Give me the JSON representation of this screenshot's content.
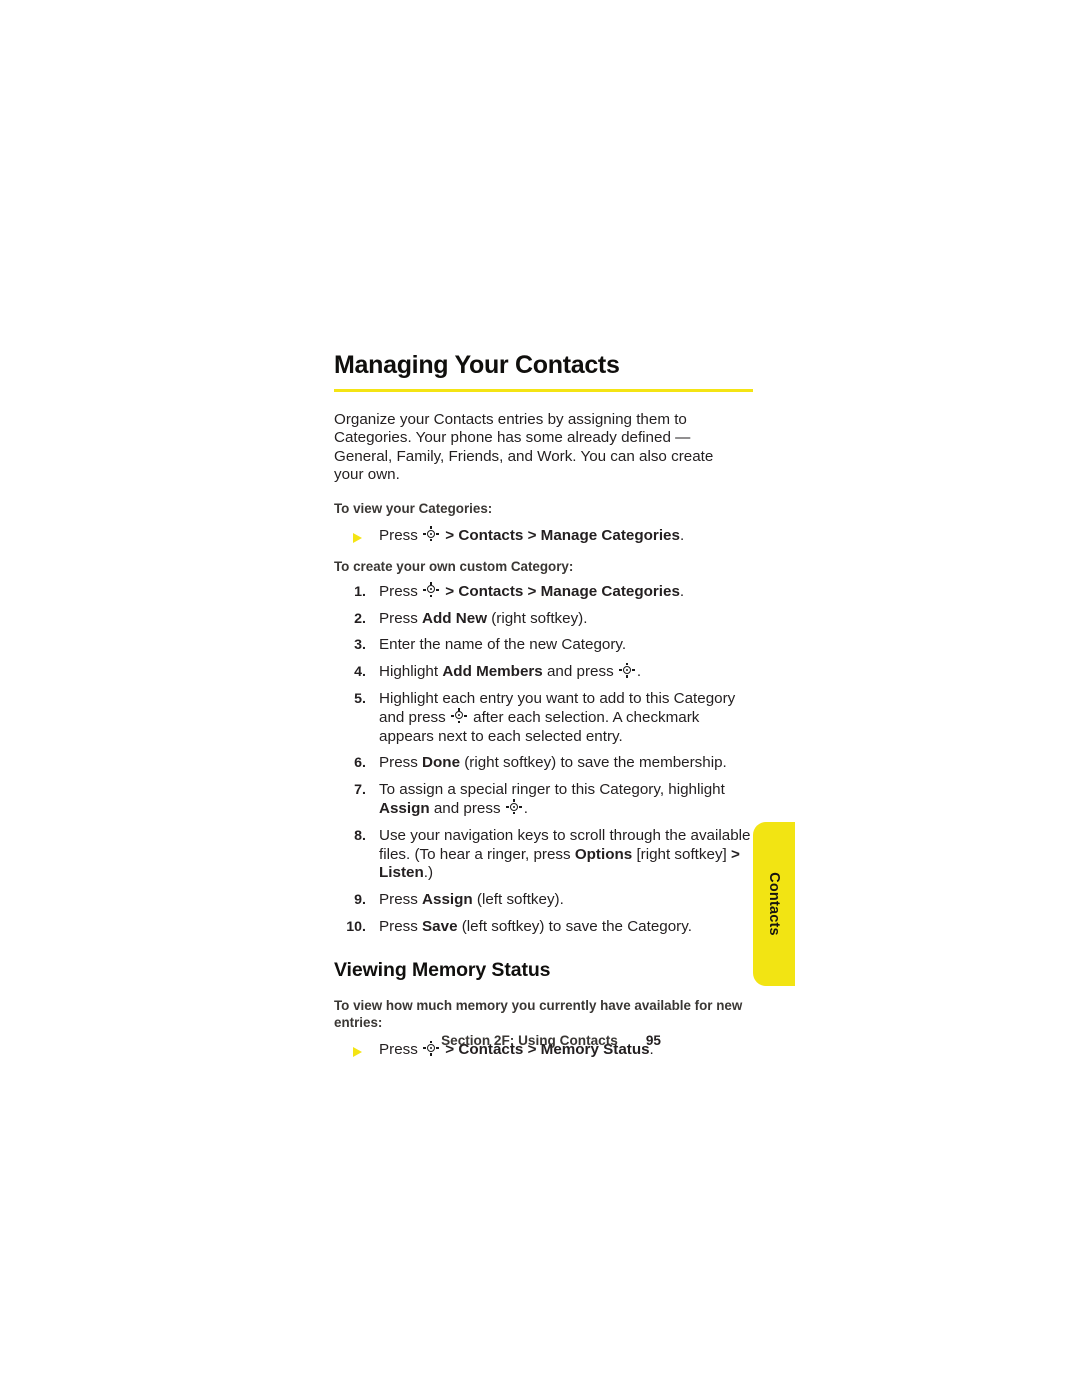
{
  "page": {
    "heading": "Managing Your Contacts",
    "accent_color": "#f2e413",
    "rule_color": "#f4e414",
    "text_color": "#231f20"
  },
  "intro": {
    "paragraph": "Organize your Contacts entries by assigning them to Categories. Your phone has some already defined — General, Family, Friends, and Work. You can also create your own."
  },
  "view_categories": {
    "subhead": "To view your Categories:",
    "bullet": {
      "press_label": "Press",
      "nav_icon": "navigation-key-icon",
      "path": "> Contacts > Manage Categories",
      "period": "."
    }
  },
  "create_category": {
    "subhead": "To create your own custom Category:",
    "steps": [
      {
        "num": "1.",
        "segments": [
          {
            "text": "Press ",
            "bold": false
          },
          {
            "icon": "navigation-key-icon"
          },
          {
            "text": " > Contacts > Manage Categories",
            "bold": true
          },
          {
            "text": ".",
            "bold": false
          }
        ]
      },
      {
        "num": "2.",
        "segments": [
          {
            "text": "Press ",
            "bold": false
          },
          {
            "text": "Add New",
            "bold": true
          },
          {
            "text": " (right softkey).",
            "bold": false
          }
        ]
      },
      {
        "num": "3.",
        "segments": [
          {
            "text": "Enter the name of the new Category.",
            "bold": false
          }
        ]
      },
      {
        "num": "4.",
        "segments": [
          {
            "text": "Highlight ",
            "bold": false
          },
          {
            "text": "Add Members",
            "bold": true
          },
          {
            "text": " and press ",
            "bold": false
          },
          {
            "icon": "navigation-key-icon"
          },
          {
            "text": ".",
            "bold": false
          }
        ]
      },
      {
        "num": "5.",
        "segments": [
          {
            "text": "Highlight each entry you want to add to this Category and press ",
            "bold": false
          },
          {
            "icon": "navigation-key-icon"
          },
          {
            "text": " after each selection. A checkmark appears next to each selected entry.",
            "bold": false
          }
        ]
      },
      {
        "num": "6.",
        "segments": [
          {
            "text": "Press ",
            "bold": false
          },
          {
            "text": "Done",
            "bold": true
          },
          {
            "text": " (right softkey) to save the membership.",
            "bold": false
          }
        ]
      },
      {
        "num": "7.",
        "segments": [
          {
            "text": "To assign a special ringer to this Category, highlight ",
            "bold": false
          },
          {
            "text": "Assign",
            "bold": true
          },
          {
            "text": " and press ",
            "bold": false
          },
          {
            "icon": "navigation-key-icon"
          },
          {
            "text": ".",
            "bold": false
          }
        ]
      },
      {
        "num": "8.",
        "segments": [
          {
            "text": "Use your navigation keys to scroll through the available files. (To hear a ringer, press ",
            "bold": false
          },
          {
            "text": "Options",
            "bold": true
          },
          {
            "text": " [right softkey] ",
            "bold": false
          },
          {
            "text": ">",
            "bold": true
          },
          {
            "text": " ",
            "bold": false
          },
          {
            "text": "Listen",
            "bold": true
          },
          {
            "text": ".)",
            "bold": false
          }
        ]
      },
      {
        "num": "9.",
        "segments": [
          {
            "text": "Press ",
            "bold": false
          },
          {
            "text": "Assign",
            "bold": true
          },
          {
            "text": " (left softkey).",
            "bold": false
          }
        ]
      },
      {
        "num": "10.",
        "segments": [
          {
            "text": "Press ",
            "bold": false
          },
          {
            "text": "Save",
            "bold": true
          },
          {
            "text": " (left softkey) to save the Category.",
            "bold": false
          }
        ]
      }
    ]
  },
  "memory_status": {
    "heading": "Viewing Memory Status",
    "subhead": "To view how much memory you currently have available for new entries:",
    "bullet": {
      "press_label": "Press",
      "nav_icon": "navigation-key-icon",
      "path": "> Contacts > Memory Status",
      "period": "."
    }
  },
  "side_tab": {
    "label": "Contacts"
  },
  "footer": {
    "section": "Section 2F: Using Contacts",
    "page_number": "95"
  }
}
